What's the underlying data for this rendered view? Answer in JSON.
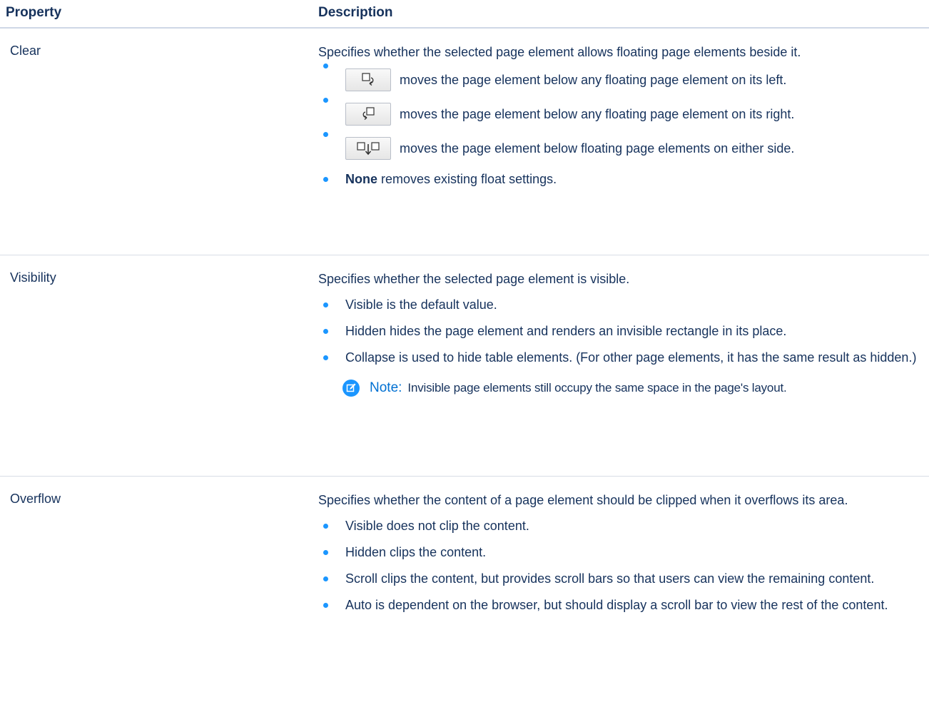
{
  "table": {
    "headers": {
      "property": "Property",
      "description": "Description"
    },
    "rows": [
      {
        "property": "Clear",
        "description": "Specifies whether the selected page element allows floating page elements beside it.",
        "items": [
          {
            "icon": "clear-left-icon",
            "text": "moves the page element below any floating page element on its left."
          },
          {
            "icon": "clear-right-icon",
            "text": "moves the page element below any floating page element on its right."
          },
          {
            "icon": "clear-both-icon",
            "text": "moves the page element below floating page elements on either side."
          }
        ],
        "none_item": {
          "bold": "None",
          "text": " removes existing float settings."
        }
      },
      {
        "property": "Visibility",
        "description": "Specifies whether the selected page element is visible.",
        "items": [
          "Visible is the default value.",
          "Hidden hides the page element and renders an invisible rectangle in its place.",
          "Collapse is used to hide table elements. (For other page elements, it has the same result as hidden.)"
        ],
        "note": {
          "label": "Note:",
          "text": "Invisible page elements still occupy the same space in the page's layout."
        }
      },
      {
        "property": "Overflow",
        "description": "Specifies whether the content of a page element should be clipped when it overflows its area.",
        "items": [
          "Visible does not clip the content.",
          "Hidden clips the content.",
          "Scroll clips the content, but provides scroll bars so that users can view the remaining content.",
          "Auto is dependent on the browser, but should display a scroll bar to view the rest of the content."
        ]
      }
    ]
  },
  "colors": {
    "text": "#16325c",
    "bullet": "#1b96ff",
    "note_label": "#0070d2"
  }
}
